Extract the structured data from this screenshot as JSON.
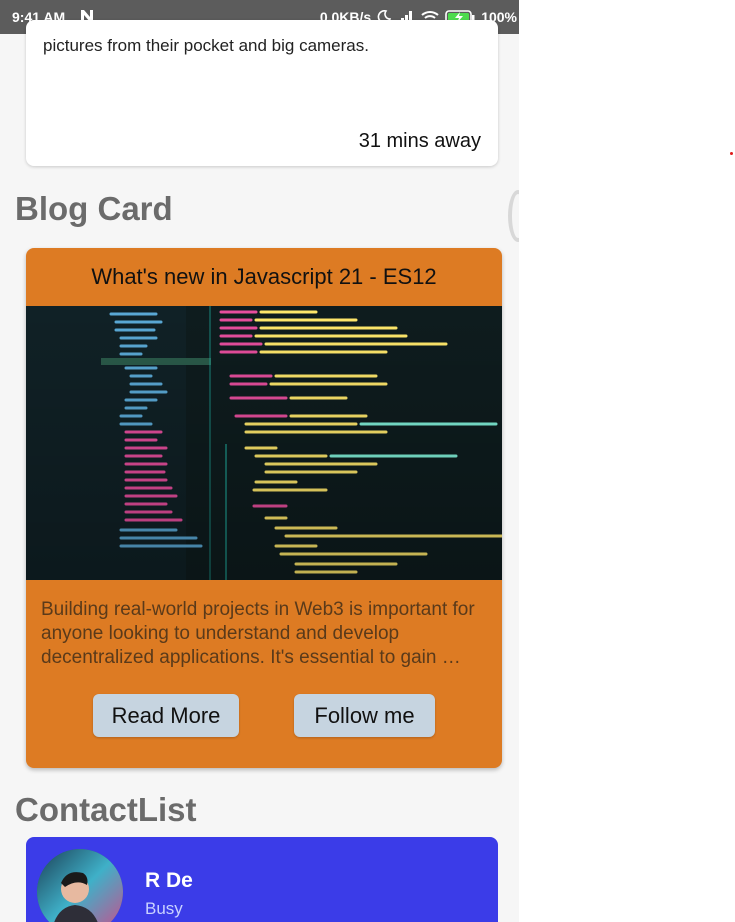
{
  "status_bar": {
    "time": "9:41 AM",
    "speed": "0.0KB/s",
    "battery": "100%"
  },
  "top_card": {
    "text": "pictures from their pocket and big cameras.",
    "meta": "31 mins away"
  },
  "blog_section": {
    "title": "Blog Card",
    "card": {
      "title": "What's new in Javascript 21 - ES12",
      "image_icon": "code-screenshot-image",
      "description": "Building real-world projects in Web3 is important for anyone looking to understand and develop decentralized applications. It's essential to gain …",
      "read_more_label": "Read More",
      "follow_label": "Follow me",
      "color": "#dd7b23",
      "button_color": "#c6d4e0"
    }
  },
  "contact_section": {
    "title": "ContactList",
    "contacts": [
      {
        "name": "R De",
        "status": "Busy",
        "color": "#3b3ce8"
      }
    ]
  }
}
